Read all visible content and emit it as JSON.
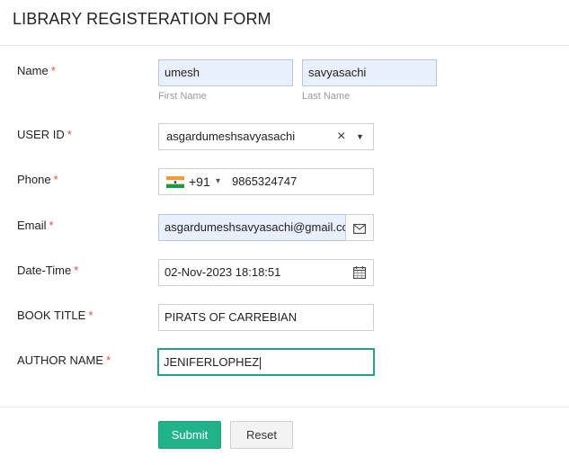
{
  "form": {
    "title": "LIBRARY REGISTERATION FORM",
    "required_mark": "*"
  },
  "fields": {
    "name": {
      "label": "Name",
      "first_value": "umesh",
      "last_value": "savyasachi",
      "first_hint": "First Name",
      "last_hint": "Last Name"
    },
    "user_id": {
      "label": "USER ID",
      "value": "asgardumeshsavyasachi",
      "clear_glyph": "×",
      "dropdown_glyph": "▼"
    },
    "phone": {
      "label": "Phone",
      "country_code": "+91",
      "country_dropdown_glyph": "▾",
      "number": "9865324747"
    },
    "email": {
      "label": "Email",
      "value": "asgardumeshsavyasachi@gmail.con"
    },
    "datetime": {
      "label": "Date-Time",
      "value": "02-Nov-2023 18:18:51"
    },
    "book_title": {
      "label": "BOOK TITLE",
      "value": "PIRATS OF CARREBIAN"
    },
    "author_name": {
      "label": "AUTHOR NAME",
      "value": "JENIFERLOPHEZ"
    }
  },
  "buttons": {
    "submit": "Submit",
    "reset": "Reset"
  },
  "colors": {
    "accent": "#22b28a",
    "required": "#e74c3c",
    "autofill": "#e8f0fe"
  }
}
